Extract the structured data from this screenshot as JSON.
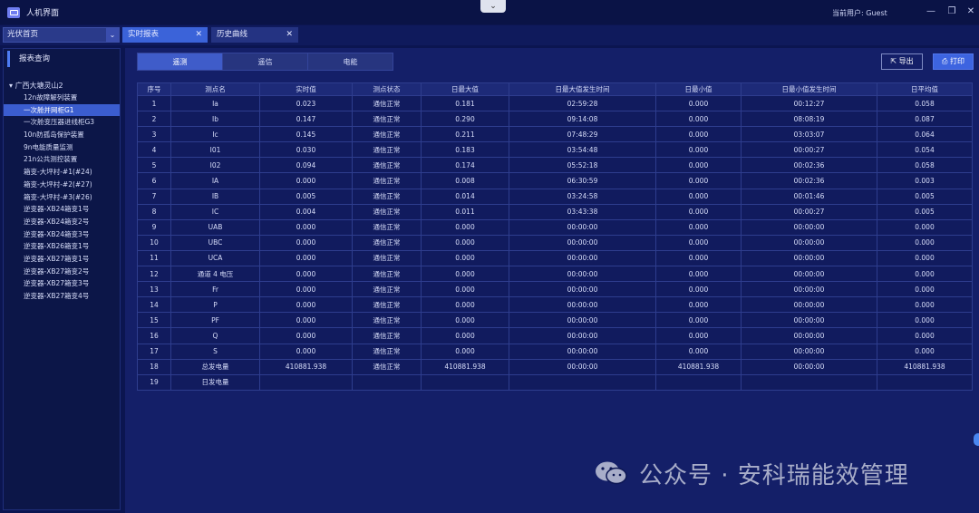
{
  "app": {
    "title": "人机界面",
    "current_user_label": "当前用户:",
    "current_user": "Guest"
  },
  "colors": {
    "background": "#0b1550",
    "accent": "#3b63d9",
    "selected": "#3b5dcf"
  },
  "site_select": {
    "value": "光伏首页"
  },
  "tabs": [
    {
      "label": "实时报表",
      "active": true
    },
    {
      "label": "历史曲线",
      "active": false
    }
  ],
  "sidebar": {
    "title": "报表查询",
    "root": "广西大塘灵山2",
    "items": [
      {
        "label": "12n故障解列装置",
        "selected": false
      },
      {
        "label": "一次舱并网柜G1",
        "selected": true
      },
      {
        "label": "一次舱变压器进线柜G3",
        "selected": false
      },
      {
        "label": "10n防孤岛保护装置",
        "selected": false
      },
      {
        "label": "9n电能质量监测",
        "selected": false
      },
      {
        "label": "21n公共测控装置",
        "selected": false
      },
      {
        "label": "箱变-大坪村-#1(#24)",
        "selected": false
      },
      {
        "label": "箱变-大坪村-#2(#27)",
        "selected": false
      },
      {
        "label": "箱变-大坪村-#3(#26)",
        "selected": false
      },
      {
        "label": "逆变器-XB24箱变1号",
        "selected": false
      },
      {
        "label": "逆变器-XB24箱变2号",
        "selected": false
      },
      {
        "label": "逆变器-XB24箱变3号",
        "selected": false
      },
      {
        "label": "逆变器-XB26箱变1号",
        "selected": false
      },
      {
        "label": "逆变器-XB27箱变1号",
        "selected": false
      },
      {
        "label": "逆变器-XB27箱变2号",
        "selected": false
      },
      {
        "label": "逆变器-XB27箱变3号",
        "selected": false
      },
      {
        "label": "逆变器-XB27箱变4号",
        "selected": false
      }
    ]
  },
  "segments": [
    {
      "label": "遥测",
      "active": true
    },
    {
      "label": "遥信",
      "active": false
    },
    {
      "label": "电能",
      "active": false
    }
  ],
  "toolbar": {
    "export_label": "导出",
    "print_label": "打印"
  },
  "table": {
    "columns": [
      "序号",
      "测点名",
      "实时值",
      "测点状态",
      "日最大值",
      "日最大值发生时间",
      "日最小值",
      "日最小值发生时间",
      "日平均值"
    ],
    "rows": [
      [
        "1",
        "Ia",
        "0.023",
        "通信正常",
        "0.181",
        "02:59:28",
        "0.000",
        "00:12:27",
        "0.058"
      ],
      [
        "2",
        "Ib",
        "0.147",
        "通信正常",
        "0.290",
        "09:14:08",
        "0.000",
        "08:08:19",
        "0.087"
      ],
      [
        "3",
        "Ic",
        "0.145",
        "通信正常",
        "0.211",
        "07:48:29",
        "0.000",
        "03:03:07",
        "0.064"
      ],
      [
        "4",
        "I01",
        "0.030",
        "通信正常",
        "0.183",
        "03:54:48",
        "0.000",
        "00:00:27",
        "0.054"
      ],
      [
        "5",
        "I02",
        "0.094",
        "通信正常",
        "0.174",
        "05:52:18",
        "0.000",
        "00:02:36",
        "0.058"
      ],
      [
        "6",
        "IA",
        "0.000",
        "通信正常",
        "0.008",
        "06:30:59",
        "0.000",
        "00:02:36",
        "0.003"
      ],
      [
        "7",
        "IB",
        "0.005",
        "通信正常",
        "0.014",
        "03:24:58",
        "0.000",
        "00:01:46",
        "0.005"
      ],
      [
        "8",
        "IC",
        "0.004",
        "通信正常",
        "0.011",
        "03:43:38",
        "0.000",
        "00:00:27",
        "0.005"
      ],
      [
        "9",
        "UAB",
        "0.000",
        "通信正常",
        "0.000",
        "00:00:00",
        "0.000",
        "00:00:00",
        "0.000"
      ],
      [
        "10",
        "UBC",
        "0.000",
        "通信正常",
        "0.000",
        "00:00:00",
        "0.000",
        "00:00:00",
        "0.000"
      ],
      [
        "11",
        "UCA",
        "0.000",
        "通信正常",
        "0.000",
        "00:00:00",
        "0.000",
        "00:00:00",
        "0.000"
      ],
      [
        "12",
        "通道 4 电压",
        "0.000",
        "通信正常",
        "0.000",
        "00:00:00",
        "0.000",
        "00:00:00",
        "0.000"
      ],
      [
        "13",
        "Fr",
        "0.000",
        "通信正常",
        "0.000",
        "00:00:00",
        "0.000",
        "00:00:00",
        "0.000"
      ],
      [
        "14",
        "P",
        "0.000",
        "通信正常",
        "0.000",
        "00:00:00",
        "0.000",
        "00:00:00",
        "0.000"
      ],
      [
        "15",
        "PF",
        "0.000",
        "通信正常",
        "0.000",
        "00:00:00",
        "0.000",
        "00:00:00",
        "0.000"
      ],
      [
        "16",
        "Q",
        "0.000",
        "通信正常",
        "0.000",
        "00:00:00",
        "0.000",
        "00:00:00",
        "0.000"
      ],
      [
        "17",
        "S",
        "0.000",
        "通信正常",
        "0.000",
        "00:00:00",
        "0.000",
        "00:00:00",
        "0.000"
      ],
      [
        "18",
        "总发电量",
        "410881.938",
        "通信正常",
        "410881.938",
        "00:00:00",
        "410881.938",
        "00:00:00",
        "410881.938"
      ],
      [
        "19",
        "日发电量",
        "",
        "",
        "",
        "",
        "",
        "",
        ""
      ]
    ]
  },
  "watermark": {
    "text": "公众号 · 安科瑞能效管理"
  }
}
